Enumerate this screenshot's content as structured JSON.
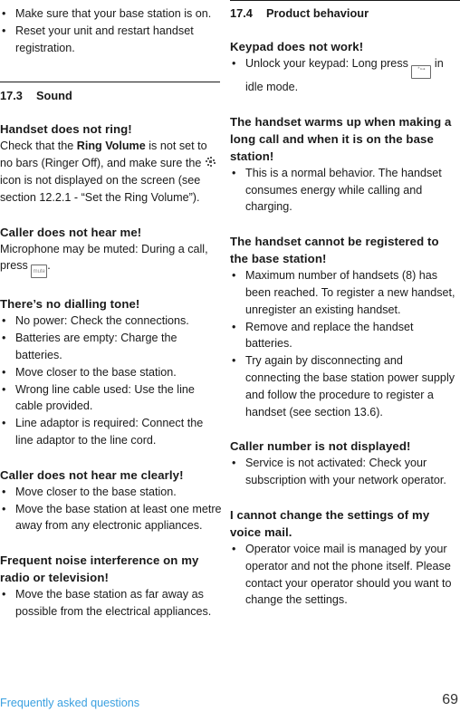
{
  "left_column": {
    "intro_bullets": [
      "Make sure that your base station is on.",
      "Reset your unit and restart handset registration."
    ],
    "section": {
      "number": "17.3",
      "title": "Sound"
    },
    "ring": {
      "heading": "Handset does not ring!",
      "text_before_bold": "Check that the ",
      "bold": "Ring Volume",
      "text_after_bold": " is not set to no bars (Ringer Off), and make sure the",
      "text_after_icon": "icon is not displayed on the screen (see section 12.2.1 - “Set the Ring Volume”).",
      "icon": "ringer-off-icon"
    },
    "mute": {
      "heading": "Caller does not hear me!",
      "text": "Microphone may be muted: During a call, press",
      "key_label": "mute",
      "text_end": "."
    },
    "dialling": {
      "heading": "There’s no dialling tone!",
      "bullets": [
        "No power: Check the connections.",
        "Batteries are empty: Charge the batteries.",
        "Move closer to the base station.",
        "Wrong line cable used: Use the line cable provided.",
        "Line adaptor is required: Connect the line adaptor to the line cord."
      ]
    },
    "clearly": {
      "heading": "Caller does not hear me clearly!",
      "bullets": [
        "Move closer to the base station.",
        "Move the base station at least one metre away from any electronic appliances."
      ]
    },
    "noise": {
      "heading": "Frequent noise interference on my radio or television!",
      "bullets": [
        "Move the base station as far away as possible from the electrical appliances."
      ]
    }
  },
  "right_column": {
    "section": {
      "number": "17.4",
      "title": "Product behaviour"
    },
    "keypad": {
      "heading": "Keypad does not work!",
      "bullet_text": "Unlock your keypad: Long press",
      "key_label": "*⊶",
      "bullet_end": "in idle mode."
    },
    "warm": {
      "heading": "The handset warms up when making a long call and when it is on the base station!",
      "bullets": [
        "This is a normal behavior. The handset consumes energy while calling and charging."
      ]
    },
    "register": {
      "heading": "The handset cannot be registered to the base station!",
      "bullets": [
        "Maximum number of handsets (8) has been reached. To register a new handset, unregister an existing handset.",
        "Remove and replace the handset batteries.",
        "Try again by disconnecting and connecting the base station power supply and follow the procedure to register a handset (see section 13.6)."
      ]
    },
    "caller_number": {
      "heading": "Caller number is not displayed!",
      "bullets": [
        "Service is not activated: Check your subscription with your network operator."
      ]
    },
    "voicemail": {
      "heading": "I cannot change the settings of my voice mail.",
      "bullets": [
        "Operator voice mail is managed by your operator and not the phone itself. Please contact your operator should you want to change the settings."
      ]
    }
  },
  "footer": {
    "section_label": "Frequently asked questions",
    "page_number": "69",
    "accent_color": "#3aa0e0"
  },
  "bullet_glyph": "•"
}
